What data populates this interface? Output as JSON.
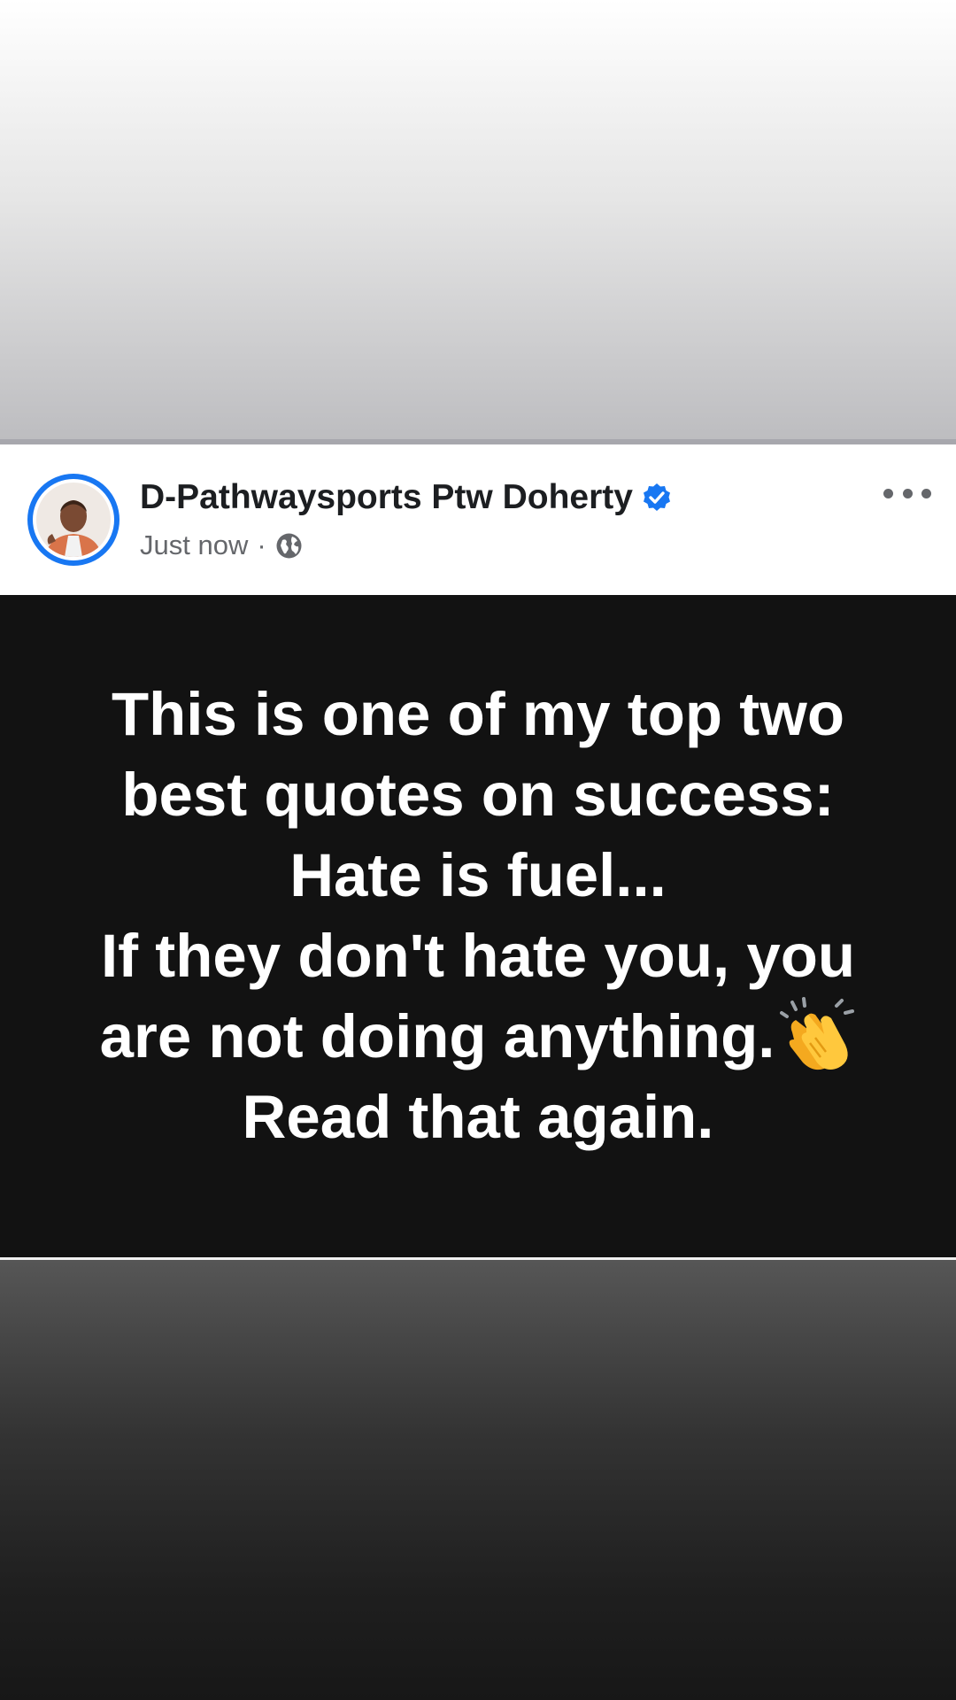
{
  "post": {
    "author_name": "D-Pathwaysports Ptw Doherty",
    "verified": true,
    "timestamp": "Just now",
    "separator": "·",
    "audience_icon": "globe-icon",
    "menu_icon": "more-options-icon",
    "avatar_icon": "profile-photo"
  },
  "quote": {
    "line1": "This is one of my top two",
    "line2": "best quotes on success:",
    "line3": "Hate is fuel...",
    "line4": "If they don't hate you, you",
    "line5": "are not doing anything.",
    "line5_emoji": "clapping-hands-emoji",
    "line6": "Read that again."
  },
  "colors": {
    "accent": "#1877f2",
    "card_background": "#121212",
    "text_secondary": "#65676b"
  }
}
